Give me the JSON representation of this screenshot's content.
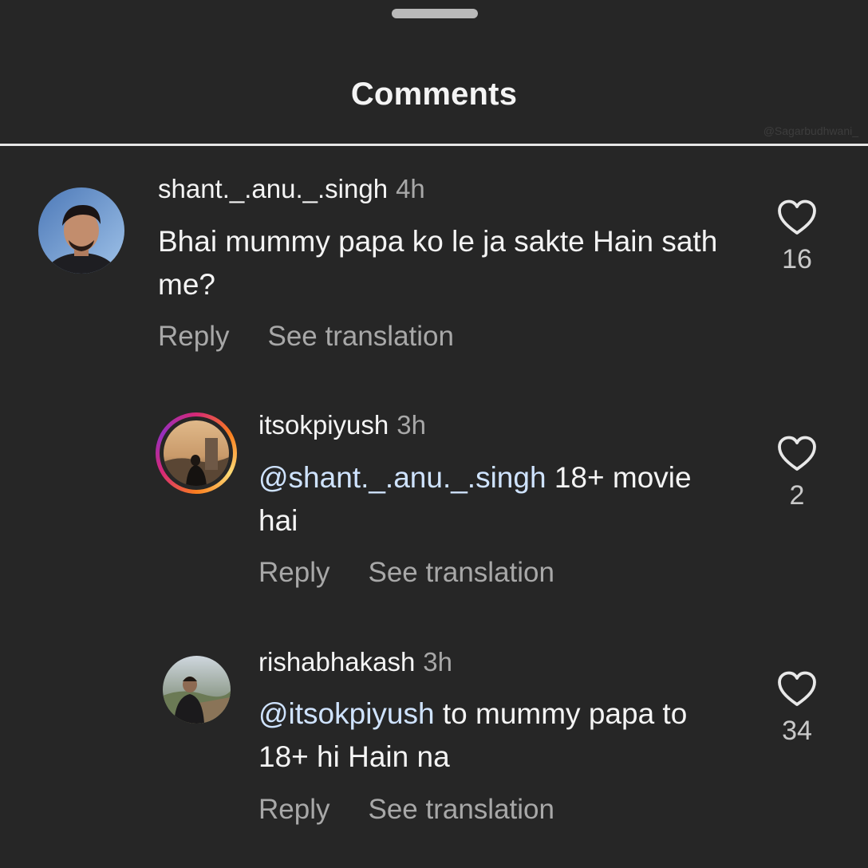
{
  "header": {
    "title": "Comments",
    "watermark": "@Sagarbudhwani_"
  },
  "comments": [
    {
      "username": "shant._.anu._.singh",
      "time": "4h",
      "text": "Bhai mummy papa ko le ja sakte Hain sath me?",
      "reply_label": "Reply",
      "translate_label": "See translation",
      "likes": "16",
      "avatar": "profile-photo-man"
    },
    {
      "username": "itsokpiyush",
      "time": "3h",
      "mention": "@shant._.anu._.singh",
      "text": "18+ movie hai",
      "reply_label": "Reply",
      "translate_label": "See translation",
      "likes": "2",
      "avatar": "profile-photo-silhouette-story-ring"
    },
    {
      "username": "rishabhakash",
      "time": "3h",
      "mention": "@itsokpiyush",
      "text": "to mummy papa to 18+ hi Hain na",
      "reply_label": "Reply",
      "translate_label": "See translation",
      "likes": "34",
      "avatar": "profile-photo-landscape"
    }
  ],
  "icons": {
    "like": "heart-outline-icon"
  }
}
